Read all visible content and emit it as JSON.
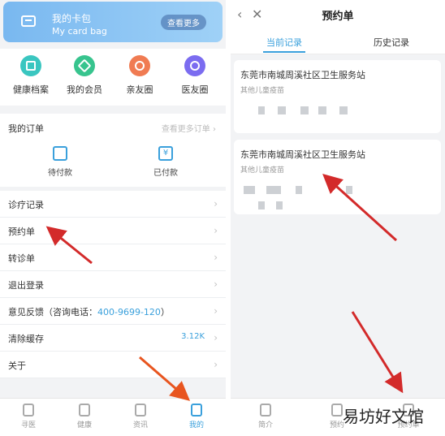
{
  "left": {
    "card": {
      "title": "我的卡包",
      "subtitle": "My card bag",
      "button": "查看更多"
    },
    "quick": [
      {
        "label": "健康档案",
        "icon": "health-file-icon",
        "color": "#3ac6c0"
      },
      {
        "label": "我的会员",
        "icon": "vip-diamond-icon",
        "color": "#37c48e"
      },
      {
        "label": "亲友圈",
        "icon": "family-add-icon",
        "color": "#f07b52"
      },
      {
        "label": "医友圈",
        "icon": "doctor-friend-icon",
        "color": "#7b6cf0"
      }
    ],
    "orders": {
      "title": "我的订单",
      "more": "查看更多订单 ›",
      "items": [
        {
          "label": "待付款",
          "icon": "wallet-icon"
        },
        {
          "label": "已付款",
          "icon": "yen-icon"
        }
      ]
    },
    "menu": [
      {
        "label": "诊疗记录"
      },
      {
        "label": "预约单"
      },
      {
        "label": "转诊单"
      },
      {
        "label": "退出登录"
      },
      {
        "label": "意见反馈（咨询电话：",
        "phone": "400-9699-120",
        "suffix": "）"
      },
      {
        "label": "清除缓存",
        "value": "3.12K"
      },
      {
        "label": "关于"
      }
    ],
    "tabbar": [
      {
        "label": "寻医",
        "icon": "find-doctor-icon"
      },
      {
        "label": "健康",
        "icon": "health-icon"
      },
      {
        "label": "资讯",
        "icon": "news-icon"
      },
      {
        "label": "我的",
        "icon": "profile-icon",
        "active": true
      }
    ]
  },
  "right": {
    "title": "预约单",
    "tabs": [
      {
        "label": "当前记录",
        "active": true
      },
      {
        "label": "历史记录"
      }
    ],
    "appointments": [
      {
        "hospital": "东莞市南城周溪社区卫生服务站",
        "type": "其他儿童疫苗"
      },
      {
        "hospital": "东莞市南城周溪社区卫生服务站",
        "type": "其他儿童疫苗"
      }
    ],
    "tabbar": [
      {
        "label": "简介",
        "icon": "intro-icon"
      },
      {
        "label": "预约",
        "icon": "appointment-icon"
      },
      {
        "label": "预约单",
        "icon": "appointment-list-icon"
      }
    ],
    "watermark": "易坊好文馆"
  },
  "colors": {
    "accent": "#3aa0dc",
    "arrow": "#d32a2a",
    "arrow_orange": "#e8551f"
  }
}
